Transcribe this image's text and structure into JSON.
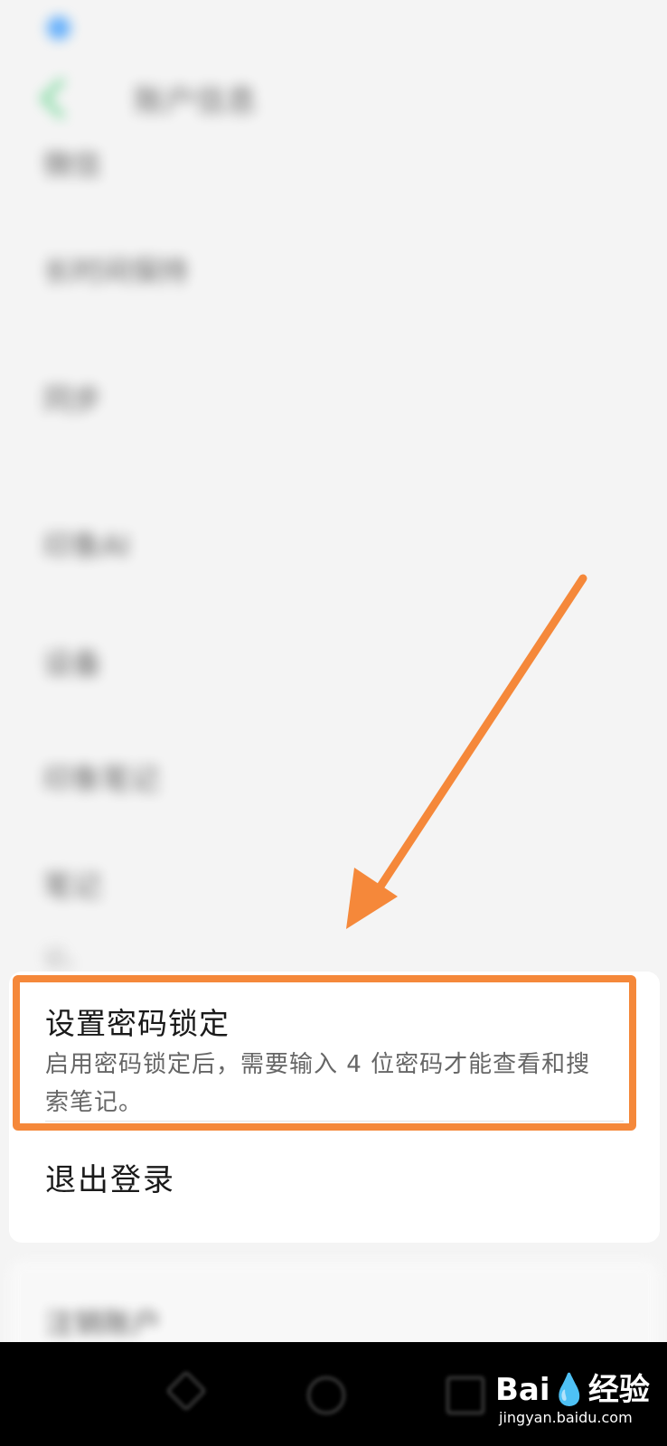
{
  "status_bar": {
    "left_text": "",
    "right_text": ""
  },
  "header": {
    "title": "账户信息"
  },
  "background_items": [
    {
      "title": "微信",
      "desc": ""
    },
    {
      "title": "长时间保持",
      "desc": ""
    },
    {
      "title": "同步",
      "desc": ""
    },
    {
      "title": "印象AI",
      "desc": ""
    },
    {
      "title": "设备",
      "desc": ""
    },
    {
      "title": "印象笔记",
      "desc": ""
    },
    {
      "title": "笔记",
      "desc": "记。"
    }
  ],
  "password_lock": {
    "title": "设置密码锁定",
    "description": "启用密码锁定后，需要输入 4 位密码才能查看和搜索笔记。"
  },
  "logout": {
    "label": "退出登录"
  },
  "bottom_card": {
    "title": "注销账户"
  },
  "watermark": {
    "text": "Bai💧经验",
    "sub": "jingyan.baidu.com"
  },
  "colors": {
    "highlight": "#f5883a",
    "arrow": "#f5883a"
  }
}
